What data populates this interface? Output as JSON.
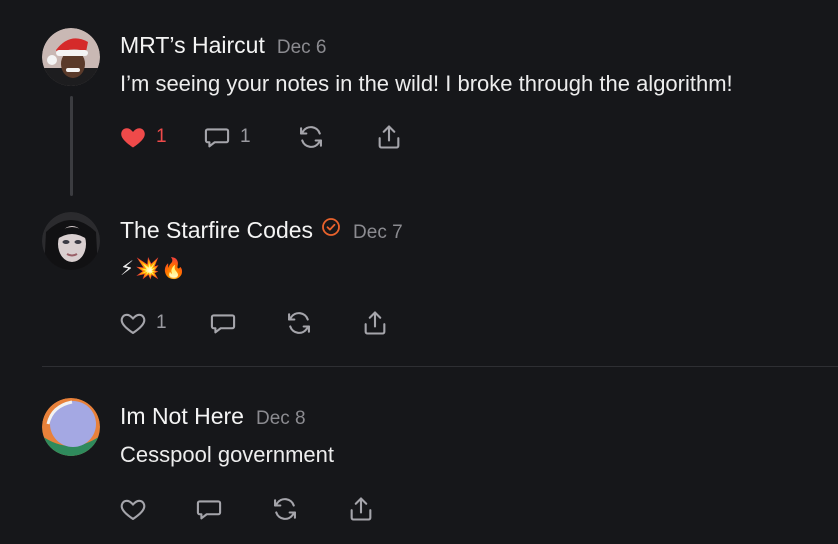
{
  "comments": [
    {
      "author": "MRT’s Haircut",
      "date": "Dec 6",
      "text": "I’m seeing your notes in the wild! I broke through the algorithm!",
      "likes": "1",
      "replies": "1",
      "liked": true
    },
    {
      "author": "The Starfire Codes",
      "date": "Dec 7",
      "text": "⚡💥🔥",
      "likes": "1",
      "verified": true
    },
    {
      "author": "Im Not Here",
      "date": "Dec 8",
      "text": "Cesspool government"
    }
  ],
  "colors": {
    "background": "#16171a",
    "like_active": "#ef4a4a",
    "verified_badge": "#e8622c",
    "icon": "#a5a5ab"
  },
  "icons": [
    "heart-icon",
    "comment-icon",
    "restack-icon",
    "share-icon",
    "verified-icon"
  ]
}
